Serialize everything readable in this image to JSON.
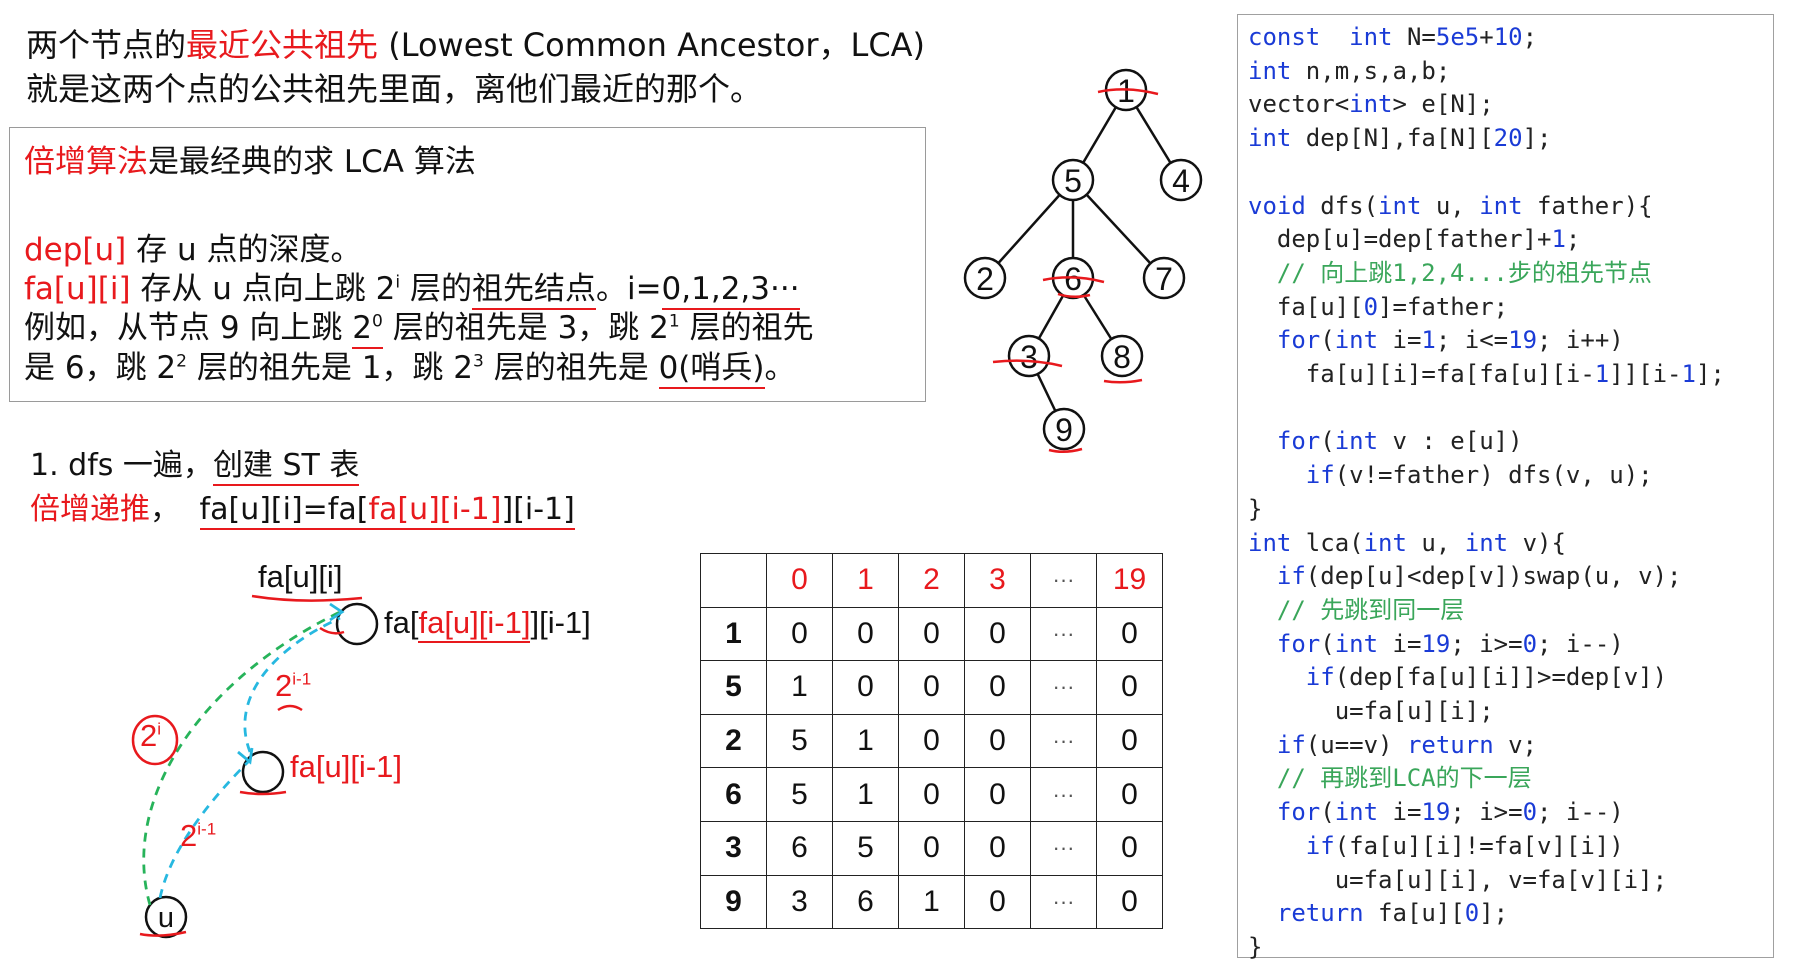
{
  "intro": {
    "line1_prefix": "两个节点的",
    "line1_highlight": "最近公共祖先",
    "line1_suffix": " (Lowest Common Ancestor，LCA)",
    "line2": "就是这两个点的公共祖先里面，离他们最近的那个。"
  },
  "box": {
    "line1_highlight": "倍增算法",
    "line1_suffix": "是最经典的求 LCA 算法",
    "dep_label": "dep[u]",
    "dep_text": " 存 u 点的深度。",
    "fa_label": "fa[u][i]",
    "fa_text_a": " 存从 u 点向上跳 2",
    "fa_sup": "i",
    "fa_text_b": " 层的",
    "fa_text_u": "祖先结点",
    "fa_text_c": "。i=",
    "fa_text_d": "0,1,2,3···",
    "ex_a": "例如，从节点 9 向上跳 ",
    "ex_b": "2",
    "ex_sup0": "0",
    "ex_c": " 层的祖先是 3，跳 2",
    "ex_sup1": "1",
    "ex_d": " 层的祖先",
    "ex2_a": "是 6，跳 2",
    "ex_sup2": "2",
    "ex2_b": " 层的祖先是 1，跳 2",
    "ex_sup3": "3",
    "ex2_c": " 层的祖先是 ",
    "ex2_d": "0(哨兵)",
    "ex2_e": "。"
  },
  "steps": {
    "s1_a": "1.   dfs 一遍，",
    "s1_b": "创建 ST 表",
    "s2_a": "倍增递推",
    "s2_b": "，",
    "s2_c": "fa[u][i]=fa[",
    "s2_d": "fa[u][i-1]",
    "s2_e": "][i-1]"
  },
  "tree": {
    "nodes": [
      "1",
      "4",
      "5",
      "2",
      "6",
      "7",
      "3",
      "8",
      "9"
    ]
  },
  "diagram": {
    "top_label": "fa[u][i]",
    "right_label_a": "fa[",
    "right_label_b": "fa[u][i-1]",
    "right_label_c": "][i-1]",
    "mid_label": "fa[u][i-1]",
    "pow_i": "2",
    "pow_i_sup": "i",
    "pow_im1": "2",
    "pow_im1_sup": "i-1",
    "pow_im1_b": "2",
    "pow_im1_b_sup": "i-1",
    "u_label": "u"
  },
  "table": {
    "header": [
      "0",
      "1",
      "2",
      "3",
      "···",
      "19"
    ],
    "rows": [
      {
        "key": "1",
        "vals": [
          "0",
          "0",
          "0",
          "0",
          "···",
          "0"
        ]
      },
      {
        "key": "5",
        "vals": [
          "1",
          "0",
          "0",
          "0",
          "···",
          "0"
        ]
      },
      {
        "key": "2",
        "vals": [
          "5",
          "1",
          "0",
          "0",
          "···",
          "0"
        ]
      },
      {
        "key": "6",
        "vals": [
          "5",
          "1",
          "0",
          "0",
          "···",
          "0"
        ]
      },
      {
        "key": "3",
        "vals": [
          "6",
          "5",
          "0",
          "0",
          "···",
          "0"
        ]
      },
      {
        "key": "9",
        "vals": [
          "3",
          "6",
          "1",
          "0",
          "···",
          "0"
        ]
      }
    ]
  },
  "code": {
    "lines": [
      [
        [
          "kw",
          "const"
        ],
        [
          "",
          "  "
        ],
        [
          "kw",
          "int"
        ],
        [
          "",
          " N="
        ],
        [
          "nm",
          "5e5"
        ],
        [
          "",
          "+"
        ],
        [
          "nm",
          "10"
        ],
        [
          "",
          ";"
        ]
      ],
      [
        [
          "kw",
          "int"
        ],
        [
          "",
          " n,m,s,a,b;"
        ]
      ],
      [
        [
          "",
          "vector<"
        ],
        [
          "kw",
          "int"
        ],
        [
          "",
          "> e[N];"
        ]
      ],
      [
        [
          "kw",
          "int"
        ],
        [
          "",
          " dep[N],fa[N]["
        ],
        [
          "nm",
          "20"
        ],
        [
          "",
          "];"
        ]
      ],
      [
        [
          "",
          ""
        ]
      ],
      [
        [
          "kw",
          "void"
        ],
        [
          "",
          " dfs("
        ],
        [
          "kw",
          "int"
        ],
        [
          "",
          " u, "
        ],
        [
          "kw",
          "int"
        ],
        [
          "",
          " father){"
        ]
      ],
      [
        [
          "",
          "  dep[u]=dep[father]+"
        ],
        [
          "nm",
          "1"
        ],
        [
          "",
          ";"
        ]
      ],
      [
        [
          "cm",
          "  // 向上跳1,2,4...步的祖先节点"
        ]
      ],
      [
        [
          "",
          "  fa[u]["
        ],
        [
          "nm",
          "0"
        ],
        [
          "",
          "]=father;"
        ]
      ],
      [
        [
          "kw",
          "  for"
        ],
        [
          "",
          "("
        ],
        [
          "kw",
          "int"
        ],
        [
          "",
          " i="
        ],
        [
          "nm",
          "1"
        ],
        [
          "",
          "; i<="
        ],
        [
          "nm",
          "19"
        ],
        [
          "",
          "; i++)"
        ]
      ],
      [
        [
          "",
          "    fa[u][i]=fa[fa[u][i-"
        ],
        [
          "nm",
          "1"
        ],
        [
          "",
          "]][i-"
        ],
        [
          "nm",
          "1"
        ],
        [
          "",
          "];"
        ]
      ],
      [
        [
          "",
          ""
        ]
      ],
      [
        [
          "kw",
          "  for"
        ],
        [
          "",
          "("
        ],
        [
          "kw",
          "int"
        ],
        [
          "",
          " v : e[u])"
        ]
      ],
      [
        [
          "kw",
          "    if"
        ],
        [
          "",
          "(v!=father) dfs(v, u);"
        ]
      ],
      [
        [
          "",
          "}"
        ]
      ],
      [
        [
          "kw",
          "int"
        ],
        [
          "",
          " lca("
        ],
        [
          "kw",
          "int"
        ],
        [
          "",
          " u, "
        ],
        [
          "kw",
          "int"
        ],
        [
          "",
          " v){"
        ]
      ],
      [
        [
          "kw",
          "  if"
        ],
        [
          "",
          "(dep[u]<dep[v])swap(u, v);"
        ]
      ],
      [
        [
          "cm",
          "  // 先跳到同一层"
        ]
      ],
      [
        [
          "kw",
          "  for"
        ],
        [
          "",
          "("
        ],
        [
          "kw",
          "int"
        ],
        [
          "",
          " i="
        ],
        [
          "nm",
          "19"
        ],
        [
          "",
          "; i>="
        ],
        [
          "nm",
          "0"
        ],
        [
          "",
          "; i--)"
        ]
      ],
      [
        [
          "kw",
          "    if"
        ],
        [
          "",
          "(dep[fa[u][i]]>=dep[v])"
        ]
      ],
      [
        [
          "",
          "      u=fa[u][i];"
        ]
      ],
      [
        [
          "kw",
          "  if"
        ],
        [
          "",
          "(u==v) "
        ],
        [
          "kw",
          "return"
        ],
        [
          "",
          " v;"
        ]
      ],
      [
        [
          "cm",
          "  // 再跳到LCA的下一层"
        ]
      ],
      [
        [
          "kw",
          "  for"
        ],
        [
          "",
          "("
        ],
        [
          "kw",
          "int"
        ],
        [
          "",
          " i="
        ],
        [
          "nm",
          "19"
        ],
        [
          "",
          "; i>="
        ],
        [
          "nm",
          "0"
        ],
        [
          "",
          "; i--)"
        ]
      ],
      [
        [
          "kw",
          "    if"
        ],
        [
          "",
          "(fa[u][i]!=fa[v][i])"
        ]
      ],
      [
        [
          "",
          "      u=fa[u][i], v=fa[v][i];"
        ]
      ],
      [
        [
          "kw",
          "  return"
        ],
        [
          "",
          " fa[u]["
        ],
        [
          "nm",
          "0"
        ],
        [
          "",
          "];"
        ]
      ],
      [
        [
          "",
          "}"
        ]
      ]
    ]
  },
  "colors": {
    "accent_red": "#e8191d",
    "keyword_blue": "#1a3bd6",
    "comment_green": "#3aa65a",
    "arrow_green": "#27b35a",
    "arrow_cyan": "#27b8e0"
  }
}
